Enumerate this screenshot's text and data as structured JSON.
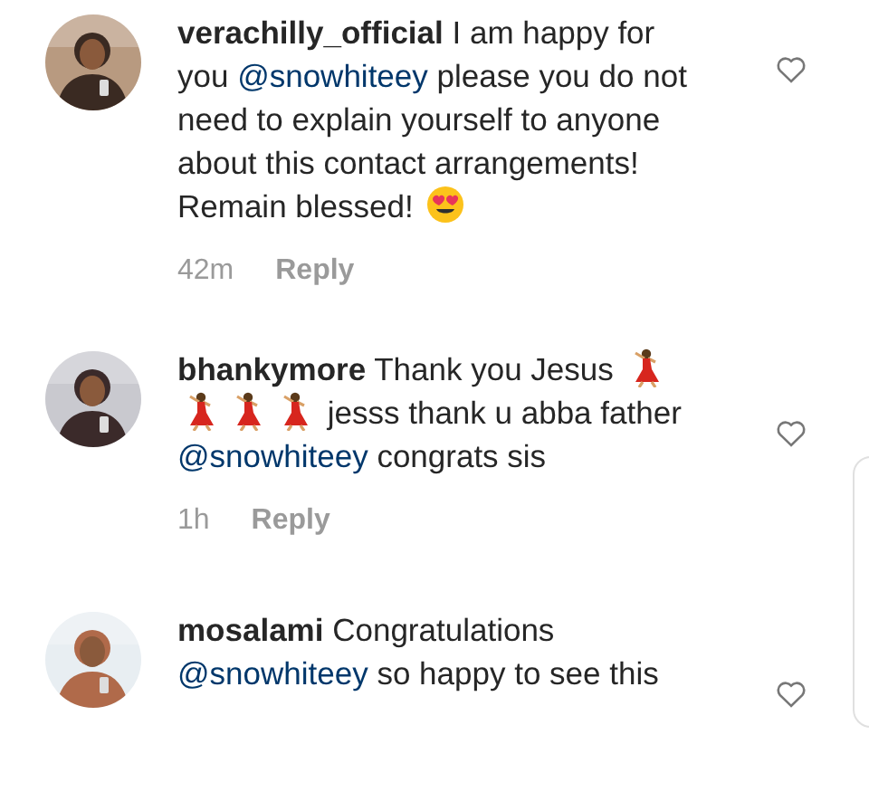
{
  "comments": [
    {
      "username": "verachilly_official",
      "avatar": {
        "kind": "picture"
      },
      "liked": false,
      "body": [
        {
          "kind": "text",
          "text": "I am happy for you "
        },
        {
          "kind": "mention",
          "text": "@snowhiteey"
        },
        {
          "kind": "text",
          "text": "  please you do not need to explain yourself to anyone about this contact arrangements! Remain blessed! "
        },
        {
          "kind": "heart-eyes-emoji"
        }
      ],
      "time": "42m",
      "reply": "Reply"
    },
    {
      "username": "bhankymore",
      "avatar": {
        "kind": "picture"
      },
      "liked": false,
      "body": [
        {
          "kind": "text",
          "text": "Thank you Jesus "
        },
        {
          "kind": "dancer-emoji"
        },
        {
          "kind": "dancer-emoji"
        },
        {
          "kind": "dancer-emoji"
        },
        {
          "kind": "dancer-emoji"
        },
        {
          "kind": "text",
          "text": " jesss thank u abba father "
        },
        {
          "kind": "mention",
          "text": "@snowhiteey"
        },
        {
          "kind": "text",
          "text": " congrats sis"
        }
      ],
      "time": "1h",
      "reply": "Reply"
    },
    {
      "username": "mosalami",
      "avatar": {
        "kind": "picture"
      },
      "liked": false,
      "body": [
        {
          "kind": "text",
          "text": "Congratulations "
        },
        {
          "kind": "mention",
          "text": "@snowhiteey"
        },
        {
          "kind": "text",
          "text": " so happy to see this"
        }
      ]
    }
  ]
}
